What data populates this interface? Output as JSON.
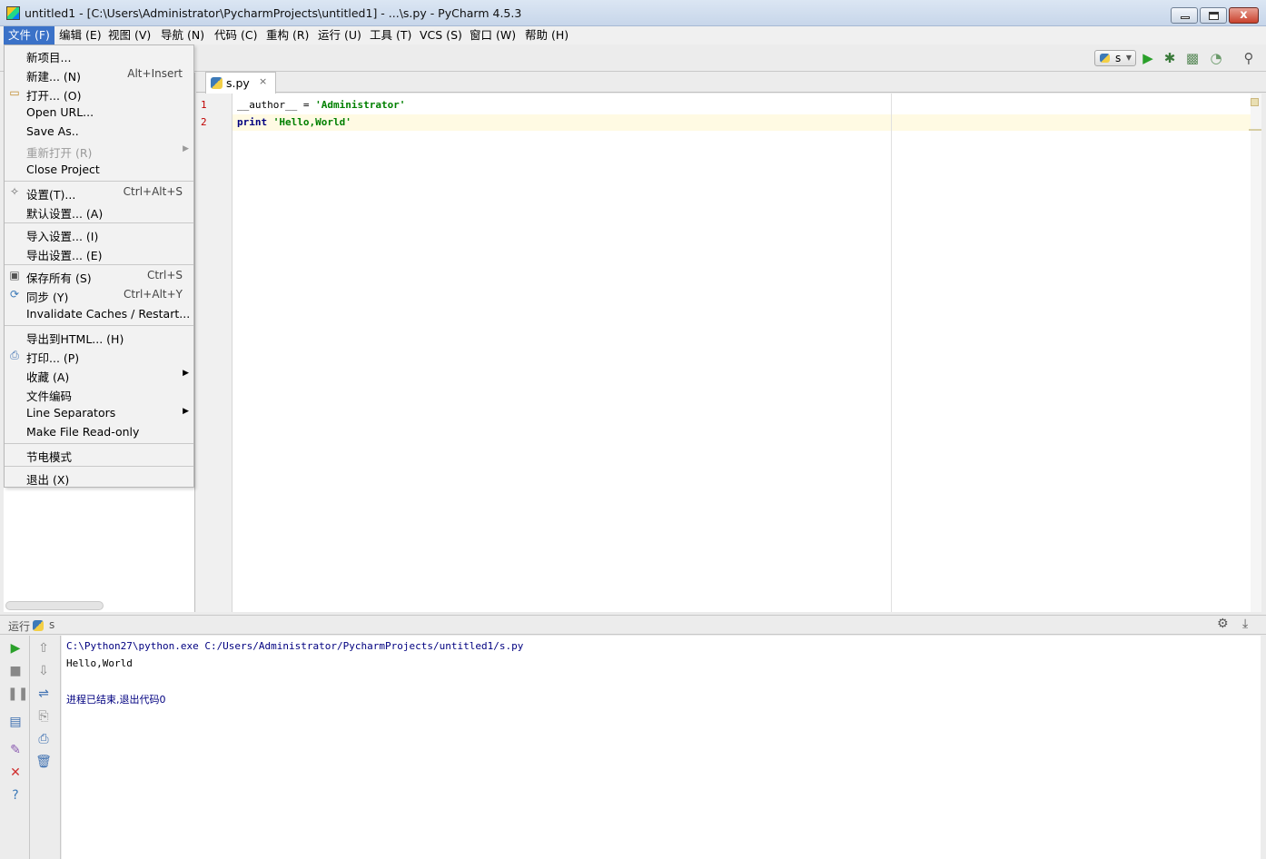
{
  "window": {
    "title": "untitled1 - [C:\\Users\\Administrator\\PycharmProjects\\untitled1] - ...\\s.py - PyCharm 4.5.3",
    "close_glyph": "x"
  },
  "menubar": {
    "items": [
      {
        "label": "文件 (F)"
      },
      {
        "label": "编辑 (E)"
      },
      {
        "label": "视图 (V)"
      },
      {
        "label": "导航 (N)"
      },
      {
        "label": "代码 (C)"
      },
      {
        "label": "重构 (R)"
      },
      {
        "label": "运行 (U)"
      },
      {
        "label": "工具 (T)"
      },
      {
        "label": "VCS (S)"
      },
      {
        "label": "窗口 (W)"
      },
      {
        "label": "帮助 (H)"
      }
    ]
  },
  "file_menu": {
    "items": [
      {
        "label": "新项目..."
      },
      {
        "label": "新建... (N)",
        "shortcut": "Alt+Insert"
      },
      {
        "label": "打开... (O)",
        "icon": "folder-icon"
      },
      {
        "label": "Open URL..."
      },
      {
        "label": "Save As.."
      },
      {
        "label": "重新打开 (R)",
        "disabled": true,
        "submenu": true
      },
      {
        "label": "Close Project"
      },
      {
        "label": "设置(T)...",
        "shortcut": "Ctrl+Alt+S",
        "icon": "wrench-icon"
      },
      {
        "label": "默认设置... (A)"
      },
      {
        "label": "导入设置... (I)"
      },
      {
        "label": "导出设置... (E)"
      },
      {
        "label": "保存所有 (S)",
        "shortcut": "Ctrl+S",
        "icon": "floppy-disk-icon"
      },
      {
        "label": "同步 (Y)",
        "shortcut": "Ctrl+Alt+Y",
        "icon": "sync-icon"
      },
      {
        "label": "Invalidate Caches / Restart..."
      },
      {
        "label": "导出到HTML... (H)"
      },
      {
        "label": "打印... (P)",
        "icon": "printer-icon"
      },
      {
        "label": "收藏 (A)",
        "submenu": true
      },
      {
        "label": "文件编码"
      },
      {
        "label": "Line Separators",
        "submenu": true
      },
      {
        "label": "Make File Read-only"
      },
      {
        "label": "节电模式"
      },
      {
        "label": "退出 (X)"
      }
    ]
  },
  "toolbar": {
    "run_config": "s",
    "icons": [
      "run-icon",
      "debug-icon",
      "run-coverage-icon",
      "profile-icon",
      "search-icon"
    ]
  },
  "editor": {
    "tab_name": "s.py",
    "tab_close": "×",
    "line_numbers": [
      "1",
      "2"
    ],
    "lines": [
      {
        "parts": [
          {
            "t": "__author__ = ",
            "c": "plain"
          },
          {
            "t": "'Administrator'",
            "c": "str"
          }
        ]
      },
      {
        "parts": [
          {
            "t": "print",
            "c": "kw"
          },
          {
            "t": " ",
            "c": "plain"
          },
          {
            "t": "'Hello,World'",
            "c": "str"
          }
        ]
      }
    ]
  },
  "run_panel": {
    "label": "运行",
    "config": "s",
    "console": [
      {
        "text": "C:\\Python27\\python.exe C:/Users/Administrator/PycharmProjects/untitled1/s.py",
        "color": "#000080"
      },
      {
        "text": "Hello,World",
        "color": "#000000"
      },
      {
        "text": "",
        "color": "#000000"
      },
      {
        "text": "进程已结束,退出代码0",
        "color": "#000080"
      }
    ]
  },
  "colors": {
    "menu_active": "#3b72c8",
    "run_green": "#2aa02a",
    "keyword": "#000080",
    "string": "#008000"
  }
}
